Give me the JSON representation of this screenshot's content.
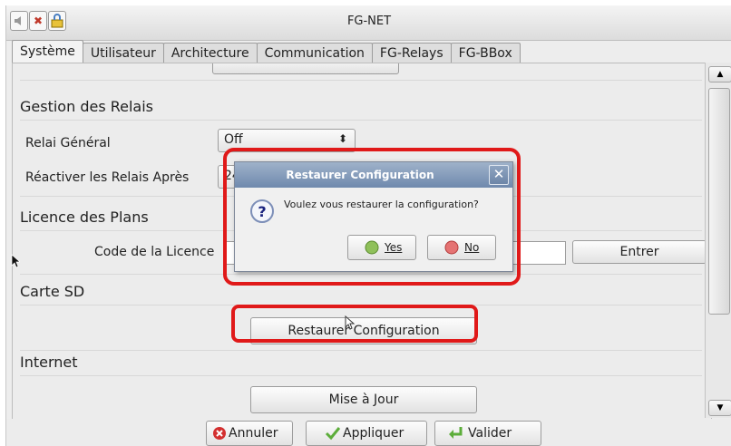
{
  "window": {
    "title": "FG-NET"
  },
  "tabs": [
    {
      "label": "Système"
    },
    {
      "label": "Utilisateur"
    },
    {
      "label": "Architecture"
    },
    {
      "label": "Communication"
    },
    {
      "label": "FG-Relays"
    },
    {
      "label": "FG-BBox"
    }
  ],
  "relais": {
    "section": "Gestion des Relais",
    "general_label": "Relai Général",
    "general_value": "Off",
    "reactiver_label": "Réactiver les Relais Après",
    "reactiver_value": "24"
  },
  "licence": {
    "section": "Licence des Plans",
    "code_label": "Code de la Licence",
    "code_value": "",
    "submit_label": "Entrer"
  },
  "sd": {
    "section": "Carte SD",
    "restore_label": "Restaurer Configuration"
  },
  "internet": {
    "section": "Internet",
    "update_label": "Mise à Jour"
  },
  "footer": {
    "cancel_label": "Annuler",
    "apply_label": "Appliquer",
    "ok_label": "Valider"
  },
  "dialog": {
    "title": "Restaurer Configuration",
    "message": "Voulez vous restaurer la configuration?",
    "yes_label": "Yes",
    "no_label": "No"
  },
  "colors": {
    "highlight": "#e01919",
    "dialog_title": "#6f89ad"
  },
  "icons": [
    "speaker-icon",
    "close-x-icon",
    "lock-icon",
    "question-icon",
    "yes-circle-icon",
    "no-circle-icon",
    "cancel-icon",
    "check-icon",
    "arrow-icon"
  ]
}
